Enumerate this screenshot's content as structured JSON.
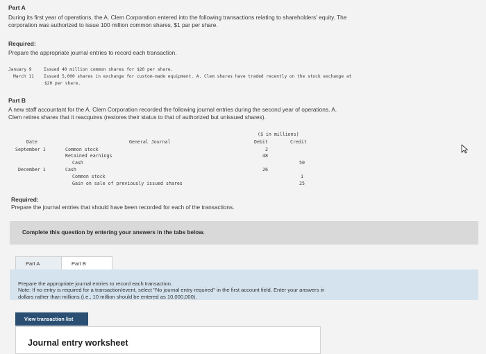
{
  "part_a": {
    "heading": "Part A",
    "intro_line1": "During its first year of operations, the A. Clem Corporation entered into the following transactions relating to shareholders' equity. The",
    "intro_line2": "corporation was authorized to issue 100 million common shares, $1 par per share.",
    "required_label": "Required:",
    "required_text": "Prepare the appropriate journal entries to record each transaction.",
    "transactions": [
      {
        "date": "January 9",
        "text": "Issued 40 million common shares for $20 per share."
      },
      {
        "date": "March 11",
        "text": "Issued 5,000 shares in exchange for custom-made equipment. A. Clem shares have traded recently on the stock exchange at",
        "text_cont": "$20 per share."
      }
    ]
  },
  "part_b": {
    "heading": "Part B",
    "intro_line1": "A new staff accountant for the A. Clem Corporation recorded the following journal entries during the second year of operations. A.",
    "intro_line2": "Clem retires shares that it reacquires (restores their status to that of authorized but unissued shares).",
    "journal": {
      "units": "($ in millions)",
      "headers": {
        "date": "Date",
        "journal": "General Journal",
        "debit": "Debit",
        "credit": "Credit"
      },
      "entries": [
        {
          "date": "September 1",
          "account": "Common stock",
          "debit": "2",
          "credit": ""
        },
        {
          "date": "",
          "account": "Retained earnings",
          "debit": "48",
          "credit": ""
        },
        {
          "date": "",
          "account": "Cash",
          "debit": "",
          "credit": "50"
        },
        {
          "date": "December 1",
          "account": "Cash",
          "debit": "26",
          "credit": ""
        },
        {
          "date": "",
          "account": "Common stock",
          "debit": "",
          "credit": "1"
        },
        {
          "date": "",
          "account": "Gain on sale of previously issued shares",
          "debit": "",
          "credit": "25"
        }
      ]
    },
    "required_label": "Required:",
    "required_text": "Prepare the journal entries that should have been recorded for each of the transactions."
  },
  "instructions_bar": "Complete this question by entering your answers in the tabs below.",
  "tabs": [
    {
      "label": "Part A"
    },
    {
      "label": "Part B"
    }
  ],
  "info": {
    "line1": "Prepare the appropriate journal entries to record each transaction.",
    "line2": "Note: If no entry is required for a transaction/event, select \"No journal entry required\" in the first account field. Enter your answers in",
    "line3": "dollars rather than millions (i.e., 10 million should be entered as 10,000,000)."
  },
  "view_transaction_button": "View transaction list",
  "worksheet_title": "Journal entry worksheet",
  "icons": {
    "cursor": "mouse-pointer-icon"
  }
}
